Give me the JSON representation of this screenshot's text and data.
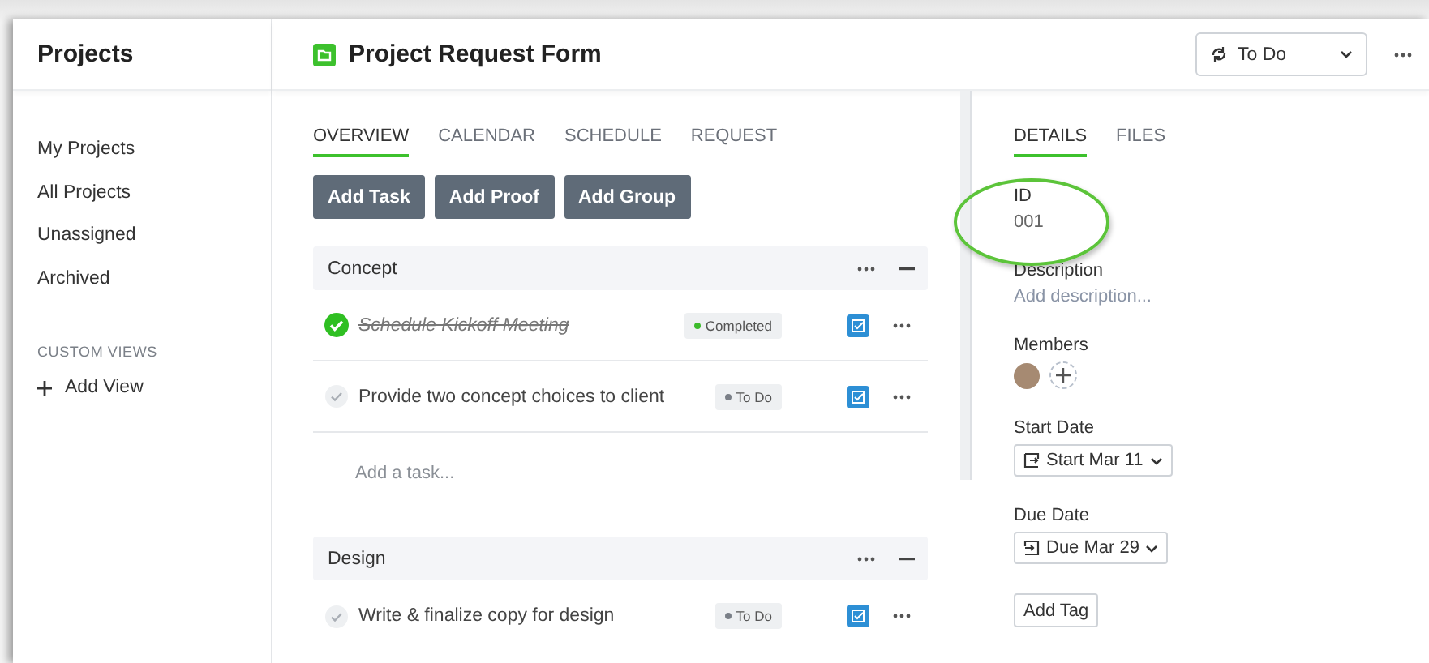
{
  "sidebar": {
    "title": "Projects",
    "items": [
      {
        "label": "My Projects",
        "selected": false
      },
      {
        "label": "All Projects",
        "selected": false
      },
      {
        "label": "Unassigned",
        "selected": false
      },
      {
        "label": "Archived",
        "selected": false
      }
    ],
    "section_title": "CUSTOM VIEWS",
    "add_view": "Add View"
  },
  "header": {
    "title": "Project Request Form",
    "status": "To Do"
  },
  "tabs": [
    {
      "label": "OVERVIEW",
      "selected": true
    },
    {
      "label": "CALENDAR",
      "selected": false
    },
    {
      "label": "SCHEDULE",
      "selected": false
    },
    {
      "label": "REQUEST",
      "selected": false
    }
  ],
  "actions": [
    "Add Task",
    "Add Proof",
    "Add Group"
  ],
  "groups": [
    {
      "name": "Concept",
      "add_placeholder": "Add a task...",
      "tasks": [
        {
          "title": "Schedule Kickoff Meeting",
          "completed": true,
          "status": "Completed",
          "color": "#3dbb2c"
        },
        {
          "title": "Provide two concept choices to client",
          "completed": false,
          "status": "To Do",
          "color": "#7a7f87"
        }
      ]
    },
    {
      "name": "Design",
      "tasks": [
        {
          "title": "Write & finalize copy for design",
          "completed": false,
          "status": "To Do",
          "color": "#7a7f87"
        }
      ]
    }
  ],
  "details": {
    "tabs": [
      {
        "label": "DETAILS",
        "selected": true
      },
      {
        "label": "FILES",
        "selected": false
      }
    ],
    "fields": [
      {
        "kind": "text",
        "label": "ID",
        "value": "001"
      },
      {
        "kind": "placeholder",
        "label": "Description",
        "value": "Add description..."
      },
      {
        "kind": "members",
        "label": "Members"
      },
      {
        "kind": "start_date",
        "label": "Start Date",
        "value": "Start Mar 11"
      },
      {
        "kind": "due_date",
        "label": "Due Date",
        "value": "Due Mar 29"
      }
    ],
    "add_tag": "Add Tag"
  }
}
